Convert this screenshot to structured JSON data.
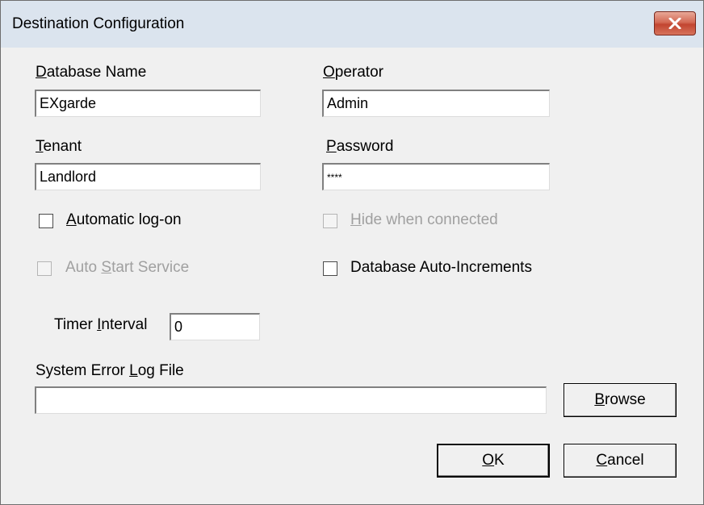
{
  "window": {
    "title": "Destination Configuration"
  },
  "fields": {
    "database_name": {
      "label_first": "D",
      "label_rest": "atabase Name",
      "value": "EXgarde"
    },
    "operator": {
      "label_first": "O",
      "label_rest": "perator",
      "value": "Admin"
    },
    "tenant": {
      "label_first": "T",
      "label_rest": "enant",
      "value": "Landlord"
    },
    "password": {
      "label_first": "P",
      "label_rest": "assword",
      "value": "****"
    },
    "timer_interval": {
      "label_pre": "Timer ",
      "label_u": "I",
      "label_post": "nterval",
      "value": "0"
    },
    "error_log": {
      "label_pre": "System Error ",
      "label_u": "L",
      "label_post": "og File",
      "value": ""
    }
  },
  "checkboxes": {
    "automatic_logon": {
      "label_u": "A",
      "label_post": "utomatic log-on",
      "checked": false,
      "enabled": true
    },
    "hide_when_connected": {
      "label_u": "H",
      "label_post": "ide when connected",
      "checked": false,
      "enabled": false
    },
    "auto_start_service": {
      "label_pre": "Auto ",
      "label_u": "S",
      "label_post": "tart Service",
      "checked": false,
      "enabled": false
    },
    "db_auto_increments": {
      "label": "Database Auto-Increments",
      "checked": false,
      "enabled": true
    }
  },
  "buttons": {
    "browse": {
      "u": "B",
      "rest": "rowse"
    },
    "ok": {
      "u": "O",
      "rest": "K"
    },
    "cancel": {
      "u": "C",
      "rest": "ancel"
    }
  },
  "icons": {
    "close": "close-x-icon"
  }
}
